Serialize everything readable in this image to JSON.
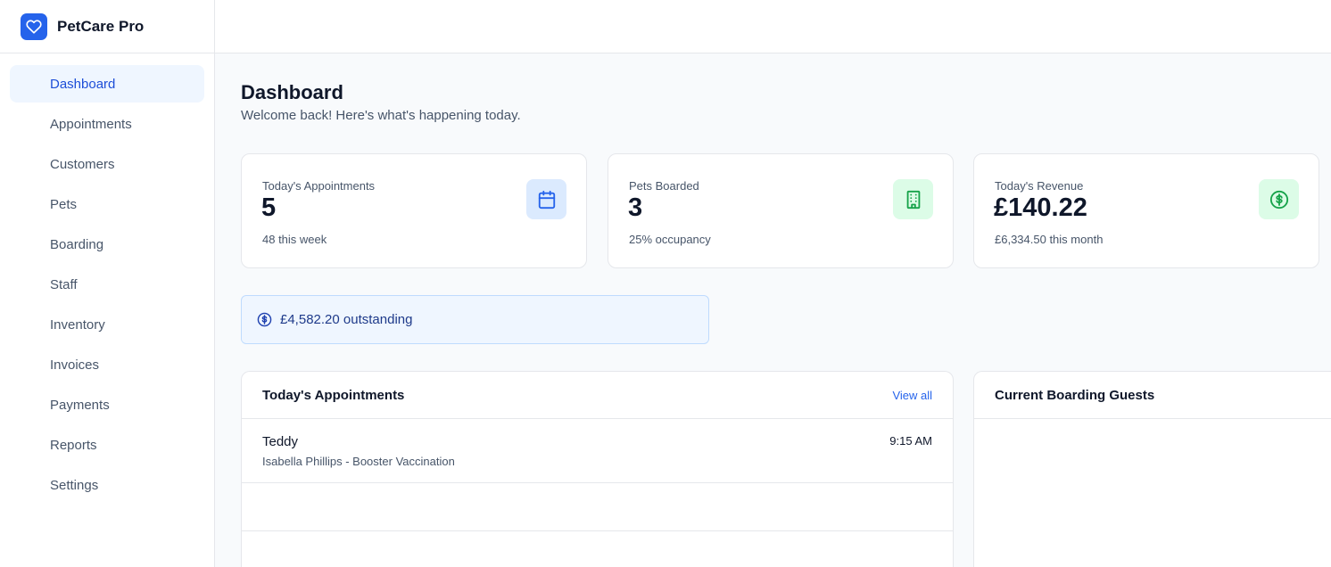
{
  "app": {
    "name": "PetCare Pro"
  },
  "sidebar": {
    "items": [
      {
        "label": "Dashboard",
        "active": true
      },
      {
        "label": "Appointments"
      },
      {
        "label": "Customers"
      },
      {
        "label": "Pets"
      },
      {
        "label": "Boarding"
      },
      {
        "label": "Staff"
      },
      {
        "label": "Inventory"
      },
      {
        "label": "Invoices"
      },
      {
        "label": "Payments"
      },
      {
        "label": "Reports"
      },
      {
        "label": "Settings"
      }
    ]
  },
  "page": {
    "title": "Dashboard",
    "subtitle": "Welcome back! Here's what's happening today."
  },
  "stats": [
    {
      "label": "Today's Appointments",
      "value": "5",
      "note": "48 this week",
      "icon": "calendar-icon",
      "icon_bg": "#dbeafe",
      "icon_color": "#2563eb"
    },
    {
      "label": "Pets Boarded",
      "value": "3",
      "note": "25% occupancy",
      "icon": "building-icon",
      "icon_bg": "#dcfce7",
      "icon_color": "#16a34a"
    },
    {
      "label": "Today's Revenue",
      "value": "£140.22",
      "note": "£6,334.50 this month",
      "icon": "dollar-circle-icon",
      "icon_bg": "#dcfce7",
      "icon_color": "#16a34a"
    }
  ],
  "outstanding": {
    "text": "£4,582.20 outstanding",
    "icon": "dollar-circle-icon"
  },
  "appointments_panel": {
    "title": "Today's Appointments",
    "link": "View all",
    "rows": [
      {
        "pet": "Teddy",
        "description": "Isabella Phillips - Booster Vaccination",
        "time": "9:15 AM"
      }
    ]
  },
  "boarding_panel": {
    "title": "Current Boarding Guests"
  },
  "colors": {
    "accent": "#2563eb",
    "active_bg": "#eff6ff",
    "success": "#16a34a"
  }
}
